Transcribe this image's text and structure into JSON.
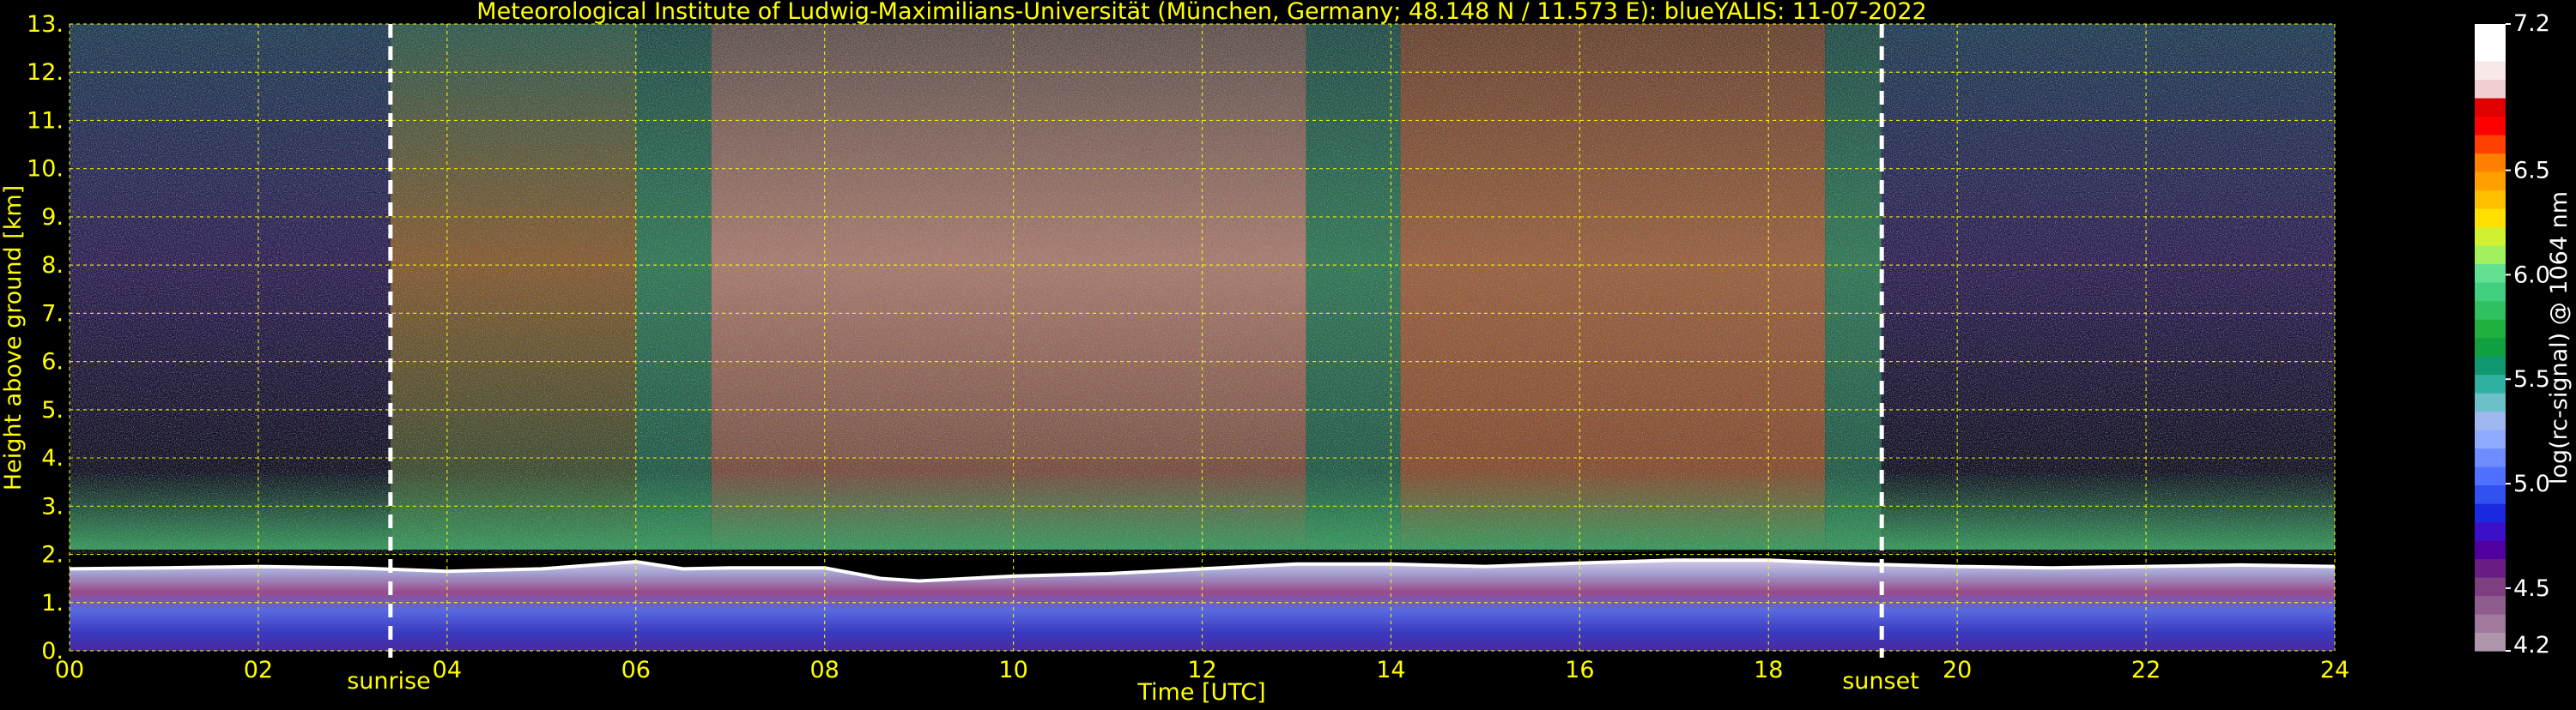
{
  "colors": {
    "background": "#000000",
    "text": "#ffff00",
    "grid": "#ffff00",
    "colorbar_text": "#ffffff",
    "day_marker": "#ffffff"
  },
  "chart_data": {
    "type": "heatmap",
    "title": "Meteorological Institute of Ludwig-Maximilians-Universität (München, Germany; 48.148 N / 11.573 E):    blueYALIS: 11-07-2022",
    "xlabel": "Time [UTC]",
    "ylabel": "Height above ground [km]",
    "xlim": [
      0,
      24
    ],
    "ylim": [
      0,
      13
    ],
    "x_ticks": [
      0,
      2,
      4,
      6,
      8,
      10,
      12,
      14,
      16,
      18,
      20,
      22,
      24
    ],
    "x_tick_labels": [
      "00",
      "02",
      "04",
      "06",
      "08",
      "10",
      "12",
      "14",
      "16",
      "18",
      "20",
      "22",
      "24"
    ],
    "y_ticks": [
      0,
      1,
      2,
      3,
      4,
      5,
      6,
      7,
      8,
      9,
      10,
      11,
      12,
      13
    ],
    "y_tick_labels": [
      "0.",
      "1.",
      "2.",
      "3.",
      "4.",
      "5.",
      "6.",
      "7.",
      "8.",
      "9.",
      "10.",
      "11.",
      "12.",
      "13."
    ],
    "grid": true,
    "annotations": [
      {
        "label": "sunrise",
        "x": 3.4
      },
      {
        "label": "sunset",
        "x": 19.2
      }
    ],
    "colorbar": {
      "label": "log(rc-signal) @ 1064 nm",
      "range": [
        4.2,
        7.2
      ],
      "ticks": [
        4.2,
        4.5,
        5.0,
        5.5,
        6.0,
        6.5,
        7.2
      ],
      "tick_labels": [
        "4.2",
        "4.5",
        "5.0",
        "5.5",
        "6.0",
        "6.5",
        "7.2"
      ],
      "colors": [
        "#ad96aa",
        "#a07a9e",
        "#8e5d8e",
        "#7d3f80",
        "#6a1e85",
        "#5000a0",
        "#3b10c8",
        "#1a28e0",
        "#3050f0",
        "#5070ff",
        "#6f8cff",
        "#8faaff",
        "#a0b8f0",
        "#6cc0c8",
        "#30b0a0",
        "#109870",
        "#10a040",
        "#20b040",
        "#30c060",
        "#40d080",
        "#60e090",
        "#a0f060",
        "#d0f030",
        "#ffe000",
        "#ffc000",
        "#ffa000",
        "#ff8000",
        "#ff4000",
        "#ff0000",
        "#e00000",
        "#f0d0d0",
        "#f8e8e8",
        "#ffffff",
        "#ffffff"
      ]
    },
    "boundary_layer_top_km": [
      [
        0,
        1.7
      ],
      [
        1,
        1.72
      ],
      [
        2,
        1.75
      ],
      [
        3,
        1.72
      ],
      [
        4,
        1.65
      ],
      [
        5,
        1.7
      ],
      [
        6,
        1.85
      ],
      [
        6.5,
        1.7
      ],
      [
        7,
        1.72
      ],
      [
        8,
        1.72
      ],
      [
        8.6,
        1.5
      ],
      [
        9,
        1.45
      ],
      [
        10,
        1.55
      ],
      [
        11,
        1.6
      ],
      [
        12,
        1.7
      ],
      [
        13,
        1.8
      ],
      [
        14,
        1.8
      ],
      [
        15,
        1.75
      ],
      [
        16,
        1.82
      ],
      [
        17,
        1.88
      ],
      [
        18,
        1.88
      ],
      [
        19,
        1.8
      ],
      [
        20,
        1.75
      ],
      [
        21,
        1.72
      ],
      [
        22,
        1.75
      ],
      [
        23,
        1.78
      ],
      [
        24,
        1.75
      ]
    ],
    "regimes": [
      {
        "x": [
          0,
          3.4
        ],
        "upper": "dark noise"
      },
      {
        "x": [
          3.4,
          6.0
        ],
        "upper": "green-orange"
      },
      {
        "x": [
          6.0,
          6.8
        ],
        "upper": "green"
      },
      {
        "x": [
          6.8,
          13.1
        ],
        "upper": "orange-white"
      },
      {
        "x": [
          13.1,
          14.1
        ],
        "upper": "green"
      },
      {
        "x": [
          14.1,
          18.6
        ],
        "upper": "orange-red"
      },
      {
        "x": [
          18.6,
          19.2
        ],
        "upper": "green"
      },
      {
        "x": [
          19.2,
          24
        ],
        "upper": "dark noise"
      }
    ]
  }
}
